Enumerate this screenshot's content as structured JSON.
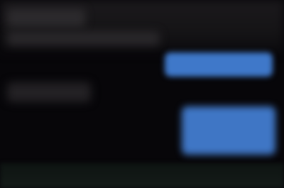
{
  "colors": {
    "background": "#070609",
    "header": "#1b191c",
    "placeholder": "#2c2a2d",
    "accent": "#3f78c9",
    "footer": "#141b18"
  },
  "note": ""
}
